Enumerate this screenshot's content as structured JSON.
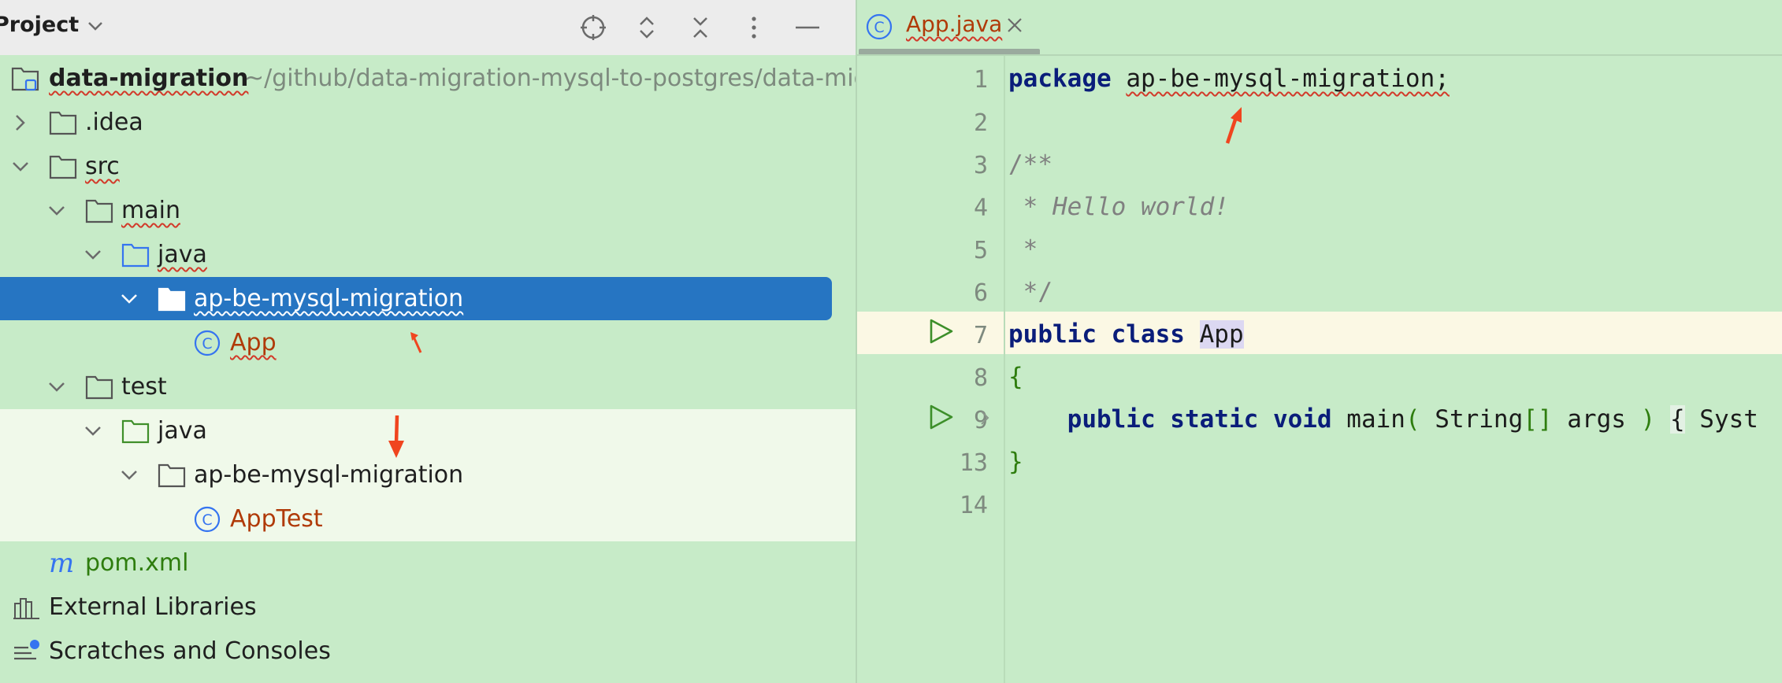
{
  "project_panel": {
    "title": "Project",
    "tree": [
      {
        "label": "data-migration",
        "path": "~/github/data-migration-mysql-to-postgres/data-migration"
      },
      {
        "label": ".idea"
      },
      {
        "label": "src"
      },
      {
        "label": "main"
      },
      {
        "label": "java"
      },
      {
        "label": "ap-be-mysql-migration"
      },
      {
        "label": "App"
      },
      {
        "label": "test"
      },
      {
        "label": "java"
      },
      {
        "label": "ap-be-mysql-migration"
      },
      {
        "label": "AppTest"
      },
      {
        "label": "pom.xml"
      },
      {
        "label": "External Libraries"
      },
      {
        "label": "Scratches and Consoles"
      }
    ]
  },
  "editor": {
    "tab_label": "App.java",
    "line_numbers": [
      "1",
      "2",
      "3",
      "4",
      "5",
      "6",
      "7",
      "8",
      "9",
      "13",
      "14"
    ],
    "code": {
      "l1_kw": "package",
      "l1_pkg": "ap-be-mysql-migration;",
      "l3": "/**",
      "l4": " * Hello world!",
      "l5": " *",
      "l6": " */",
      "l7_kw": "public class",
      "l7_cls": "App",
      "l8": "{",
      "l9_kw": "public static void",
      "l9_method": "main",
      "l9_paren_open": "(",
      "l9_type": "String",
      "l9_brackets": "[]",
      "l9_arg": "args",
      "l9_paren_close": ")",
      "l9_brace": "{",
      "l9_rest": "Syst",
      "l13": "}"
    }
  },
  "colors": {
    "background": "#c7ebc8",
    "selection": "#2675c2",
    "annotation_arrow": "#f0451f",
    "keyword": "#0a1d7a",
    "class_icon": "#3574f0"
  }
}
